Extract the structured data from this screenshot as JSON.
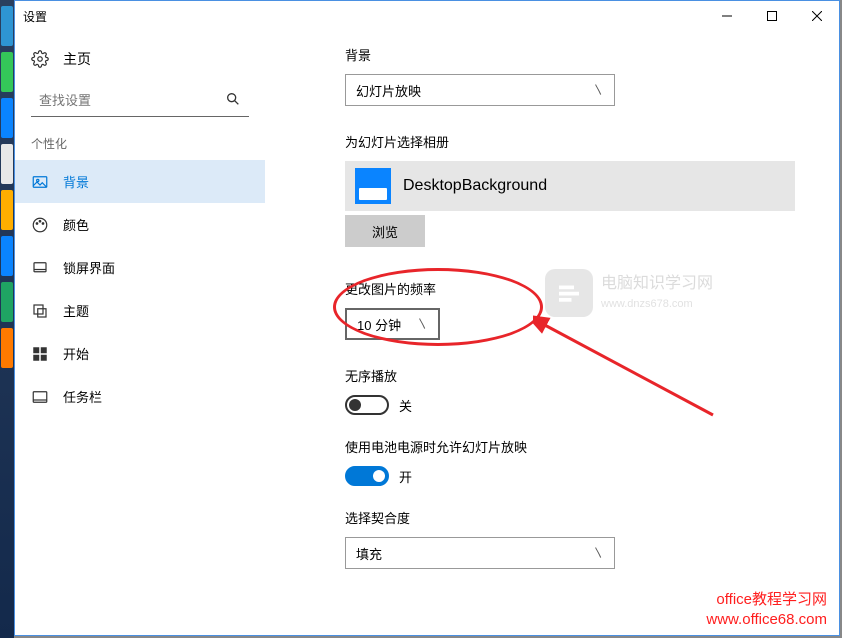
{
  "window": {
    "title": "设置"
  },
  "home": {
    "label": "主页"
  },
  "search": {
    "placeholder": "查找设置"
  },
  "category": "个性化",
  "nav": {
    "items": [
      {
        "label": "背景"
      },
      {
        "label": "颜色"
      },
      {
        "label": "锁屏界面"
      },
      {
        "label": "主题"
      },
      {
        "label": "开始"
      },
      {
        "label": "任务栏"
      }
    ]
  },
  "main": {
    "background_label": "背景",
    "background_value": "幻灯片放映",
    "album_label": "为幻灯片选择相册",
    "album_name": "DesktopBackground",
    "browse": "浏览",
    "freq_label": "更改图片的频率",
    "freq_value": "10 分钟",
    "shuffle_label": "无序播放",
    "shuffle_state": "关",
    "battery_label": "使用电池电源时允许幻灯片放映",
    "battery_state": "开",
    "fit_label": "选择契合度",
    "fit_value": "填充"
  },
  "watermark": {
    "line1": "电脑知识学习网",
    "line2": "www.dnzs678.com"
  },
  "office_wm": {
    "line1": "office教程学习网",
    "line2": "www.office68.com"
  }
}
